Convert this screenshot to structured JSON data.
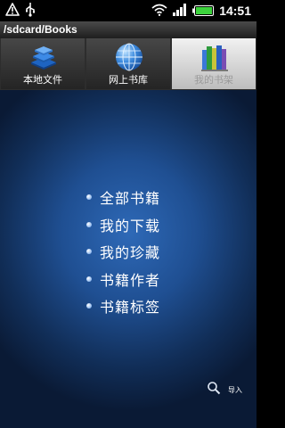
{
  "status_bar": {
    "time": "14:51",
    "icons": [
      "warning-icon",
      "usb-icon",
      "wifi-icon",
      "signal-icon",
      "battery-icon"
    ]
  },
  "path": "/sdcard/Books",
  "tabs": [
    {
      "label": "本地文件",
      "icon": "books-stack-icon",
      "active": false
    },
    {
      "label": "网上书库",
      "icon": "globe-icon",
      "active": false
    },
    {
      "label": "我的书架",
      "icon": "bookshelf-icon",
      "active": true
    }
  ],
  "menu": {
    "items": [
      {
        "label": "全部书籍"
      },
      {
        "label": "我的下载"
      },
      {
        "label": "我的珍藏"
      },
      {
        "label": "书籍作者"
      },
      {
        "label": "书籍标签"
      }
    ]
  },
  "import": {
    "label": "导入",
    "icon": "search-icon"
  },
  "colors": {
    "accent": "#1f4f92",
    "active_tab": "#e6e6e6",
    "battery": "#3cd23c"
  }
}
